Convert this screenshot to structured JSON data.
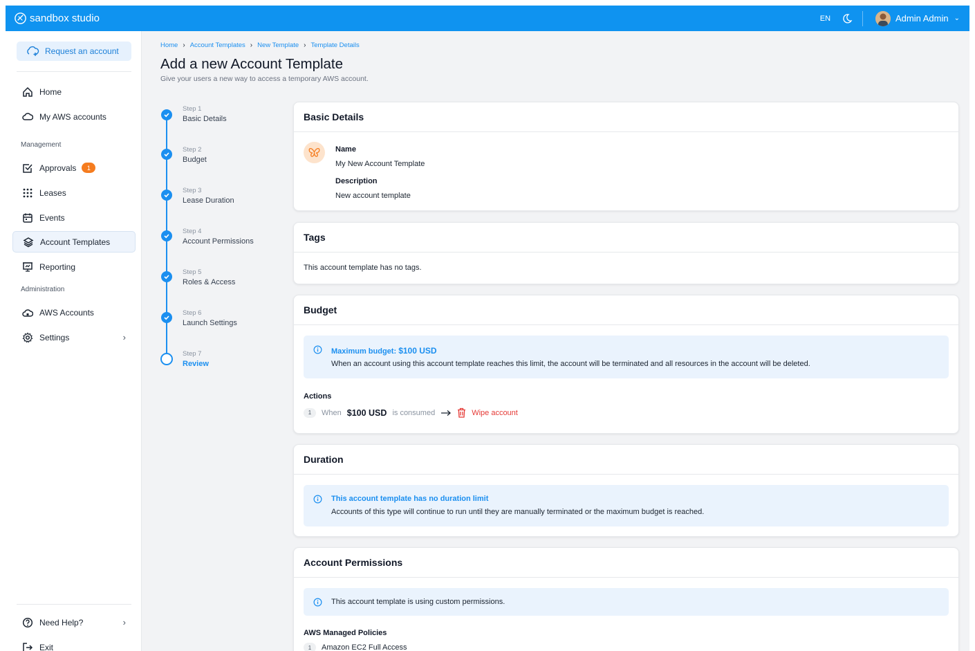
{
  "app": {
    "name": "sandbox studio",
    "lang": "EN",
    "user": "Admin Admin"
  },
  "sidebar": {
    "request_button": "Request an account",
    "items": {
      "home": "Home",
      "my_aws": "My AWS accounts",
      "management": "Management",
      "approvals": "Approvals",
      "approvals_badge": "1",
      "leases": "Leases",
      "events": "Events",
      "account_templates": "Account Templates",
      "reporting": "Reporting",
      "administration": "Administration",
      "aws_accounts": "AWS Accounts",
      "settings": "Settings",
      "need_help": "Need Help?",
      "exit": "Exit"
    }
  },
  "breadcrumb": [
    "Home",
    "Account Templates",
    "New Template",
    "Template Details"
  ],
  "page": {
    "title": "Add a new Account Template",
    "subtitle": "Give your users a new way to access a temporary AWS account."
  },
  "steps": [
    {
      "num": "Step 1",
      "label": "Basic Details",
      "done": true
    },
    {
      "num": "Step 2",
      "label": "Budget",
      "done": true
    },
    {
      "num": "Step 3",
      "label": "Lease Duration",
      "done": true
    },
    {
      "num": "Step 4",
      "label": "Account Permissions",
      "done": true
    },
    {
      "num": "Step 5",
      "label": "Roles & Access",
      "done": true
    },
    {
      "num": "Step 6",
      "label": "Launch Settings",
      "done": true
    },
    {
      "num": "Step 7",
      "label": "Review",
      "done": false
    }
  ],
  "basic": {
    "title": "Basic Details",
    "name_label": "Name",
    "name_value": "My New Account Template",
    "desc_label": "Description",
    "desc_value": "New account template"
  },
  "tags": {
    "title": "Tags",
    "empty": "This account template has no tags."
  },
  "budget": {
    "title": "Budget",
    "info_prefix": "Maximum budget:",
    "info_amount": "$100 USD",
    "info_text": "When an account using this account template reaches this limit, the account will be terminated and all resources in the account will be deleted.",
    "actions_label": "Actions",
    "action_index": "1",
    "action_when": "When",
    "action_amount": "$100 USD",
    "action_consumed": "is consumed",
    "action_result": "Wipe account"
  },
  "duration": {
    "title": "Duration",
    "info_title": "This account template has no duration limit",
    "info_text": "Accounts of this type will continue to run until they are manually terminated or the maximum budget is reached."
  },
  "permissions": {
    "title": "Account Permissions",
    "info_text": "This account template is using custom permissions.",
    "policies_label": "AWS Managed Policies",
    "policy_index": "1",
    "policy_name": "Amazon EC2 Full Access"
  },
  "colors": {
    "primary": "#0f93f0",
    "accent": "#1b8ff0",
    "danger": "#e53935",
    "badge": "#f57c1f"
  }
}
